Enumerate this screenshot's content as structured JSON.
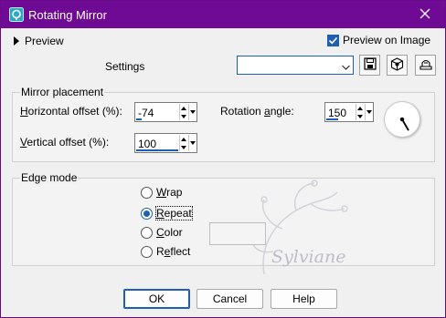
{
  "window": {
    "title": "Rotating Mirror",
    "app_icon": "rotating-mirror-app-icon",
    "close_icon": "close-icon"
  },
  "preview": {
    "toggle_label": "Preview",
    "preview_on_image_label": "Preview on Image",
    "preview_on_image_checked": true
  },
  "settings": {
    "label": "Settings",
    "value": "",
    "buttons": [
      "save-preset-icon",
      "reset-defaults-icon",
      "dialog-options-icon"
    ]
  },
  "mirror_placement": {
    "group_label": "Mirror placement",
    "horizontal_offset_label": "Horizontal offset (%):",
    "horizontal_offset_value": "-74",
    "horizontal_offset_fraction": 0.13,
    "vertical_offset_label": "Vertical offset (%):",
    "vertical_offset_value": "100",
    "vertical_offset_fraction": 1.0,
    "rotation_angle_label": "Rotation angle:",
    "rotation_angle_value": "150",
    "rotation_angle_fraction": 0.42
  },
  "edge_mode": {
    "group_label": "Edge mode",
    "options": [
      "Wrap",
      "Repeat",
      "Color",
      "Reflect"
    ],
    "selected": "Repeat"
  },
  "watermark": {
    "text": "Sylviane"
  },
  "buttons": {
    "ok": "OK",
    "cancel": "Cancel",
    "help": "Help"
  },
  "colors": {
    "titlebar": "#6e0a93",
    "accent": "#1f5fb3",
    "dialog_bg": "#f0f0f0"
  }
}
